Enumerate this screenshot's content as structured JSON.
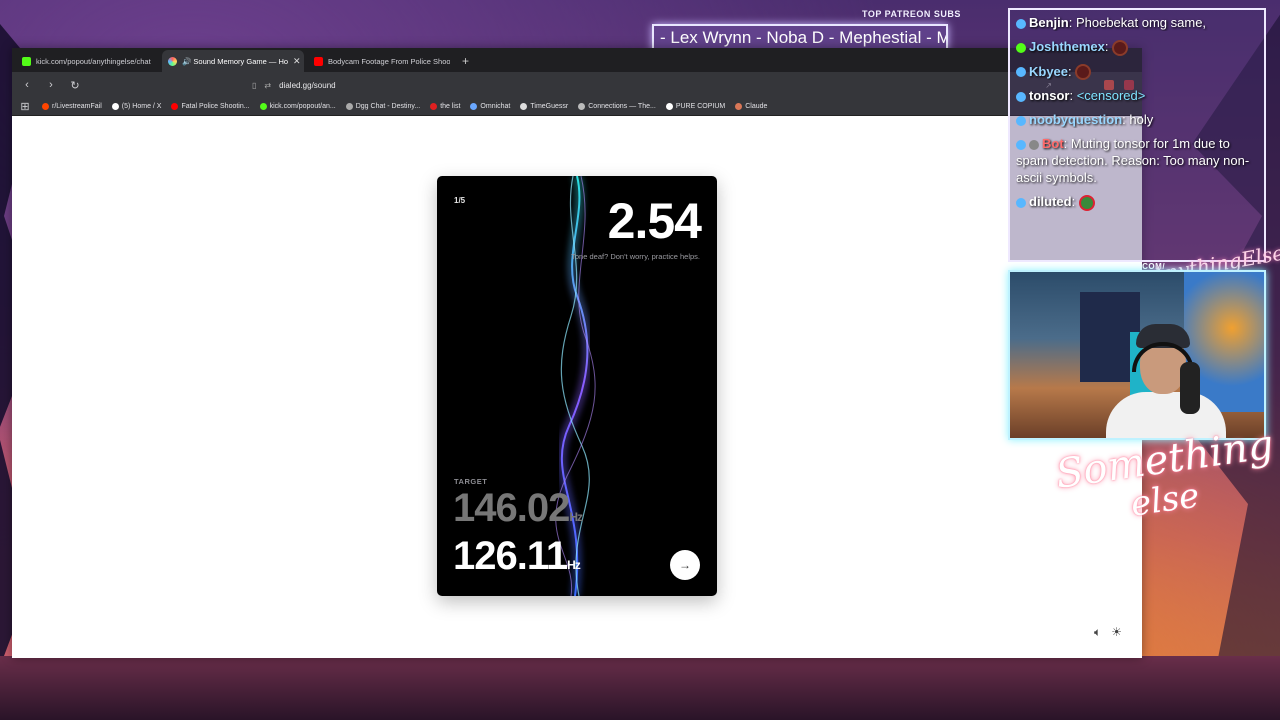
{
  "overlay": {
    "subs_label": "TOP PATREON SUBS",
    "subs_ticker": "- Lex Wrynn -  Noba D - Mephestial - M",
    "patreon_url": "PATREON.COM/",
    "patreon_sig": "AnythingElse",
    "signature_line1": "Something",
    "signature_line2": "else"
  },
  "browser": {
    "tabs": [
      {
        "label": "kick.com/popout/anythingelse/chat",
        "icon": "kick-icon"
      },
      {
        "label": "🔊 Sound Memory Game — Ho",
        "icon": "dialed-icon",
        "active": true
      },
      {
        "label": "Bodycam Footage From Police Shoot",
        "icon": "youtube-icon"
      }
    ],
    "url": "dialed.gg/sound",
    "bookmarks": [
      "r/LivestreamFail",
      "(5) Home / X",
      "Fatal Police Shootin...",
      "kick.com/popout/an...",
      "Dgg Chat - Destiny...",
      "the list",
      "Omnichat",
      "TimeGuessr",
      "Connections — The...",
      "PURE COPIUM",
      "Claude"
    ]
  },
  "game": {
    "round": "1/5",
    "score": "2.54",
    "verdict": "Tone deaf? Don't worry, practice helps.",
    "target_label": "TARGET",
    "target_value": "146.02",
    "guess_value": "126.11",
    "unit": "Hz",
    "colors": {
      "wave_cyan": "#29e0e0",
      "wave_purple": "#8a5cff",
      "wave_blue": "#3a6cff"
    }
  },
  "chat": {
    "messages": [
      {
        "user": "Benjin",
        "text": "Phoebekat omg same,",
        "color": "#ffffff"
      },
      {
        "user": "Joshthemex",
        "text": "",
        "color": "#9ad7ff"
      },
      {
        "user": "Kbyee",
        "text": "",
        "color": "#9ad7ff"
      },
      {
        "user": "tonsor",
        "text": "<censored>",
        "color": "#ffffff"
      },
      {
        "user": "noobyquestion",
        "text": "holy",
        "color": "#9ad7ff"
      },
      {
        "user": "Bot",
        "text": "Muting tonsor for 1m due to spam detection. Reason: Too many non-ascii symbols.",
        "color": "#ff6b6b"
      },
      {
        "user": "diluted",
        "text": "",
        "color": "#ffffff"
      }
    ]
  }
}
